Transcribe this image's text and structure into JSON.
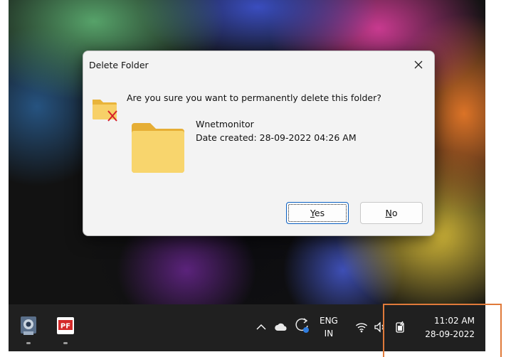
{
  "dialog": {
    "title": "Delete Folder",
    "question": "Are you sure you want to permanently delete this folder?",
    "item_name": "Wnetmonitor",
    "item_date": "Date created: 28-09-2022 04:26 AM",
    "yes_first": "Y",
    "yes_rest": "es",
    "no_first": "N",
    "no_rest": "o"
  },
  "taskbar": {
    "lang_line1": "ENG",
    "lang_line2": "IN",
    "time": "11:02 AM",
    "date": "28-09-2022",
    "apps": [
      "webcam-app-icon",
      "pdf-app-icon"
    ]
  },
  "icons": {
    "close": "close-icon",
    "tray": [
      "chevron-up-icon",
      "cloud-icon",
      "sync-icon",
      "wifi-icon",
      "volume-icon",
      "battery-icon"
    ]
  },
  "colors": {
    "accent": "#0a60c2",
    "folder_yellow": "#f4c44a",
    "taskbar": "#202020",
    "annotation": "#e07a3a"
  }
}
